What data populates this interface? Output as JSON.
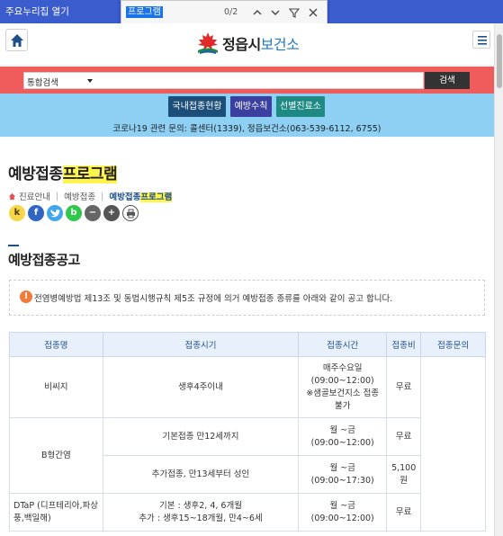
{
  "browser": {
    "favorites_label": "주요누리집 열기",
    "find": {
      "query": "프로그램",
      "count": "0/2"
    }
  },
  "header": {
    "logo_name": "정읍시",
    "logo_sub": "보건소"
  },
  "search": {
    "select_label": "통합검색",
    "button_label": "검색"
  },
  "quick_links": [
    "국내접종현황",
    "예방수칙",
    "선별진료소"
  ],
  "covid_info": "코로나19 관련 문의: 콜센터(1339), 정읍보건소(063-539-6112, 6755)",
  "page": {
    "title_prefix": "예방접종",
    "title_highlight": "프로그램",
    "breadcrumb": {
      "home": "진료안내",
      "mid": "예방접종",
      "current_prefix": "예방접종",
      "current_highlight": "프로그램"
    },
    "share_buttons": [
      "k",
      "f",
      "t",
      "b",
      "−",
      "+",
      "print"
    ],
    "section_title": "예방접종공고",
    "notice": "전염병예방법 제13조 및 동법시행규칙 제5조 규정에 의거 예방접종 종류를 아래와 같이 공고 합니다."
  },
  "table": {
    "headers": [
      "접종명",
      "접종시기",
      "접종시간",
      "접종비",
      "접종문의"
    ],
    "rows": [
      {
        "name": "비씨지",
        "period": "생후4주이내",
        "time": "매주수요일\n(09:00~12:00)\n※샘골보건지소 접종 불가",
        "fee": "무료"
      },
      {
        "name": "B형간염",
        "period": "기본접종 만12세까지",
        "time": "월 ~금\n(09:00~12:00)",
        "fee": "무료"
      },
      {
        "name": "",
        "period": "추가접종, 만13세부터 성인",
        "time": "월 ~금\n(09:00~17:30)",
        "fee": "5,100\n원"
      },
      {
        "name": "DTaP (디프테리아,파상풍,백일해)",
        "period": "기본 : 생후2, 4, 6개월\n추가 : 생후15~18개월, 만4~6세",
        "time": "월 ~금\n(09:00~12:00)",
        "fee": "무료"
      }
    ]
  },
  "colors": {
    "browser_bar": "#3a5ccc",
    "search_band": "#f05c5c",
    "quick_band": "#8dd0f4",
    "highlight": "#fff34d",
    "accent": "#1f4f8a"
  }
}
